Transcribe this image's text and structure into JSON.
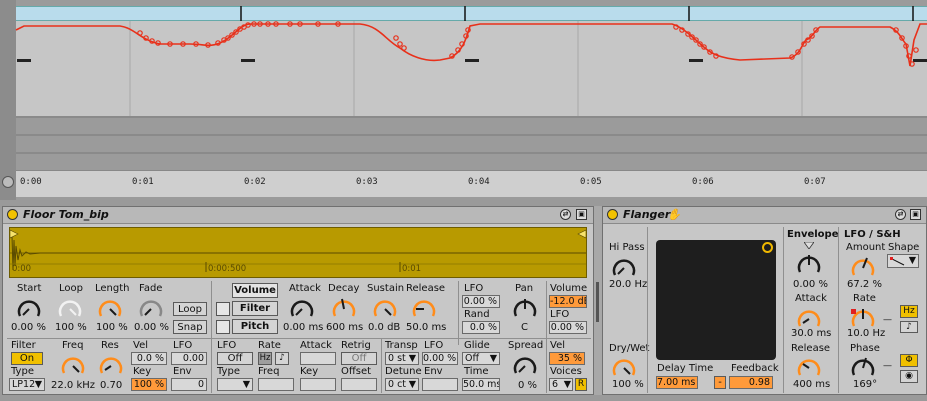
{
  "ruler": {
    "ticks": [
      "0:00",
      "0:01",
      "0:02",
      "0:03",
      "0:04",
      "0:05",
      "0:06",
      "0:07"
    ]
  },
  "sampler": {
    "title": "Floor Tom_bip",
    "wave_ticks": [
      "0:00",
      "0:00:500",
      "0:01"
    ],
    "start": {
      "label": "Start",
      "value": "0.00 %"
    },
    "loop": {
      "label": "Loop",
      "value": "100 %"
    },
    "length": {
      "label": "Length",
      "value": "100 %"
    },
    "fade": {
      "label": "Fade",
      "value": "0.00 %"
    },
    "loop_btn": "Loop",
    "snap_btn": "Snap",
    "mode_volume": "Volume",
    "mode_filter": "Filter",
    "mode_pitch": "Pitch",
    "attack": {
      "label": "Attack",
      "value": "0.00 ms"
    },
    "decay": {
      "label": "Decay",
      "value": "600 ms"
    },
    "sustain": {
      "label": "Sustain",
      "value": "0.0 dB"
    },
    "release": {
      "label": "Release",
      "value": "50.0 ms"
    },
    "lfo_label": "LFO",
    "lfo_value": "0.00 %",
    "rand_label": "Rand",
    "rand_value": "0.0 %",
    "pan": {
      "label": "Pan",
      "value": "C"
    },
    "volume": {
      "label": "Volume",
      "value": "-12.0 dB"
    },
    "vol_lfo_label": "LFO",
    "vol_lfo_value": "0.00 %",
    "filter": {
      "label": "Filter",
      "toggle": "On",
      "type_label": "Type",
      "type_value": "LP12"
    },
    "freq": {
      "label": "Freq",
      "value": "22.0 kHz"
    },
    "res": {
      "label": "Res",
      "value": "0.70"
    },
    "vel_label": "Vel",
    "vel_value": "0.0 %",
    "key_label": "Key",
    "key_value": "100 %",
    "f_lfo_label": "LFO",
    "f_lfo_value": "0.00",
    "env_label": "Env",
    "env_value": "0",
    "lfo2": {
      "label": "LFO",
      "toggle": "Off",
      "type_label": "Type"
    },
    "rate": {
      "label": "Rate",
      "hz": "Hz",
      "note": "♪",
      "freq_label": "Freq"
    },
    "lattack_label": "Attack",
    "lkey_label": "Key",
    "retrig": {
      "label": "Retrig",
      "value": "Off"
    },
    "offset_label": "Offset",
    "transp": {
      "label": "Transp",
      "value": "0 st"
    },
    "t_lfo_label": "LFO",
    "t_lfo_value": "0.00 %",
    "detune": {
      "label": "Detune",
      "value": "0 ct"
    },
    "t_env_label": "Env",
    "glide": {
      "label": "Glide",
      "value": "Off"
    },
    "time": {
      "label": "Time",
      "value": "50.0 ms"
    },
    "spread": {
      "label": "Spread",
      "value": "0 %"
    },
    "v_vel_label": "Vel",
    "v_vel_value": "35 %",
    "voices": {
      "label": "Voices",
      "value": "6",
      "r": "R"
    }
  },
  "flanger": {
    "title": "Flanger",
    "hipass": {
      "label": "Hi Pass",
      "value": "20.0 Hz"
    },
    "drywet": {
      "label": "Dry/Wet",
      "value": "100 %"
    },
    "delay": {
      "label": "Delay Time",
      "value": "7.00 ms"
    },
    "feedback": {
      "label": "Feedback",
      "value": "0.98",
      "minus": "-"
    },
    "envelope": {
      "label": "Envelope",
      "value": "0.00 %"
    },
    "env_attack": {
      "label": "Attack",
      "value": "30.0 ms"
    },
    "env_release": {
      "label": "Release",
      "value": "400 ms"
    },
    "lfo_title": "LFO / S&H",
    "amount": {
      "label": "Amount",
      "value": "67.2 %"
    },
    "shape": {
      "label": "Shape"
    },
    "rate": {
      "label": "Rate",
      "value": "10.0 Hz",
      "hz": "Hz",
      "note": "♪"
    },
    "phase": {
      "label": "Phase",
      "value": "169°",
      "phi": "Φ"
    }
  }
}
